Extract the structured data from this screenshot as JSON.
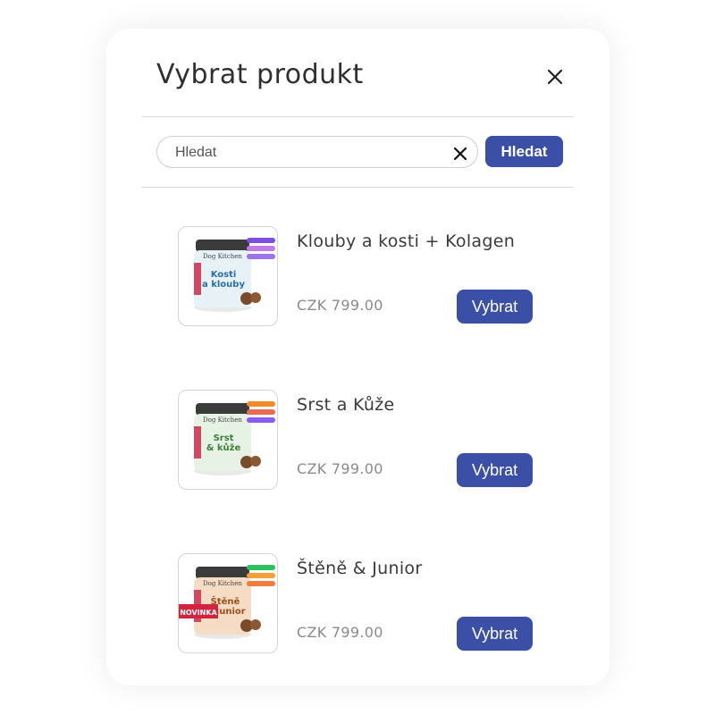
{
  "modal": {
    "title": "Vybrat produkt"
  },
  "search": {
    "placeholder": "Hledat",
    "value": "",
    "button_label": "Hledat"
  },
  "products": [
    {
      "name": "Klouby a kosti + Kolagen",
      "price": "CZK 799.00",
      "button_label": "Vybrat",
      "jar_label": "Kosti a klouby",
      "side_label": "PREMIUM",
      "brand": "Dog Kitchen",
      "colors": {
        "label_bg": "#e7f1f8",
        "label_text": "#2a6fa8",
        "lid": "#3b3b3b"
      },
      "tag_colors": [
        "#7d4fe0",
        "#c27ae8",
        "#9a74e8"
      ]
    },
    {
      "name": "Srst a Kůže",
      "price": "CZK 799.00",
      "button_label": "Vybrat",
      "jar_label": "Srst a kůže",
      "side_label": "PREMIUM",
      "brand": "Dog Kitchen",
      "colors": {
        "label_bg": "#e6f3e4",
        "label_text": "#3f7d3a",
        "lid": "#3b3b3b"
      },
      "tag_colors": [
        "#f08a2c",
        "#e96a50",
        "#8a5cf0"
      ]
    },
    {
      "name": "Štěně & Junior",
      "price": "CZK 799.00",
      "button_label": "Vybrat",
      "jar_label": "Štěně a Junior",
      "side_label": "PREMIUM",
      "brand": "Dog Kitchen",
      "badge": "NOVINKA",
      "colors": {
        "label_bg": "#f6dcc4",
        "label_text": "#a04e1a",
        "lid": "#3b3b3b"
      },
      "tag_colors": [
        "#2fbf5f",
        "#f2a03a",
        "#ef7e3a"
      ]
    }
  ]
}
